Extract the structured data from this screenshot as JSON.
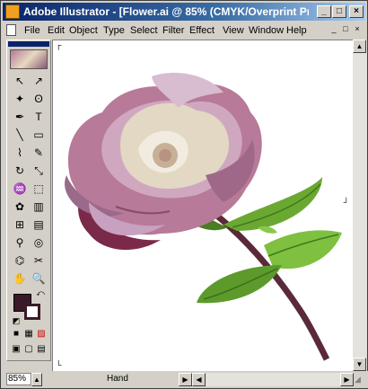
{
  "window": {
    "title": "Adobe Illustrator - [Flower.ai @ 85% (CMYK/Overprint Pre..."
  },
  "titlebar_buttons": [
    "_",
    "□",
    "×"
  ],
  "menu": {
    "items": [
      "File",
      "Edit",
      "Object",
      "Type",
      "Select",
      "Filter",
      "Effect",
      "View",
      "Window",
      "Help"
    ]
  },
  "mdi_buttons": [
    "_",
    "□",
    "×"
  ],
  "toolbox": {
    "tools": [
      {
        "name": "selection-tool",
        "glyph": "↖"
      },
      {
        "name": "direct-selection-tool",
        "glyph": "↗"
      },
      {
        "name": "magic-wand-tool",
        "glyph": "✦"
      },
      {
        "name": "lasso-tool",
        "glyph": "ʘ"
      },
      {
        "name": "pen-tool",
        "glyph": "✒"
      },
      {
        "name": "type-tool",
        "glyph": "T"
      },
      {
        "name": "line-segment-tool",
        "glyph": "╲"
      },
      {
        "name": "rectangle-tool",
        "glyph": "▭"
      },
      {
        "name": "paintbrush-tool",
        "glyph": "⌇"
      },
      {
        "name": "pencil-tool",
        "glyph": "✎"
      },
      {
        "name": "rotate-tool",
        "glyph": "↻"
      },
      {
        "name": "scale-tool",
        "glyph": "⤡"
      },
      {
        "name": "warp-tool",
        "glyph": "♒"
      },
      {
        "name": "free-transform-tool",
        "glyph": "⬚"
      },
      {
        "name": "symbol-sprayer-tool",
        "glyph": "✿"
      },
      {
        "name": "graph-tool",
        "glyph": "▥"
      },
      {
        "name": "mesh-tool",
        "glyph": "⊞"
      },
      {
        "name": "gradient-tool",
        "glyph": "▤"
      },
      {
        "name": "eyedropper-tool",
        "glyph": "⚲"
      },
      {
        "name": "blend-tool",
        "glyph": "◎"
      },
      {
        "name": "slice-tool",
        "glyph": "⌬"
      },
      {
        "name": "scissors-tool",
        "glyph": "✂"
      },
      {
        "name": "hand-tool",
        "glyph": "✋"
      },
      {
        "name": "zoom-tool",
        "glyph": "🔍"
      }
    ],
    "fill_color": "#3a1a28",
    "stroke_color": "#3a1a28",
    "mode_glyphs": [
      "■",
      "▦",
      "▨"
    ],
    "screen_glyphs": [
      "▣",
      "▢",
      "▤"
    ]
  },
  "status": {
    "zoom": "85%",
    "tool": "Hand"
  }
}
